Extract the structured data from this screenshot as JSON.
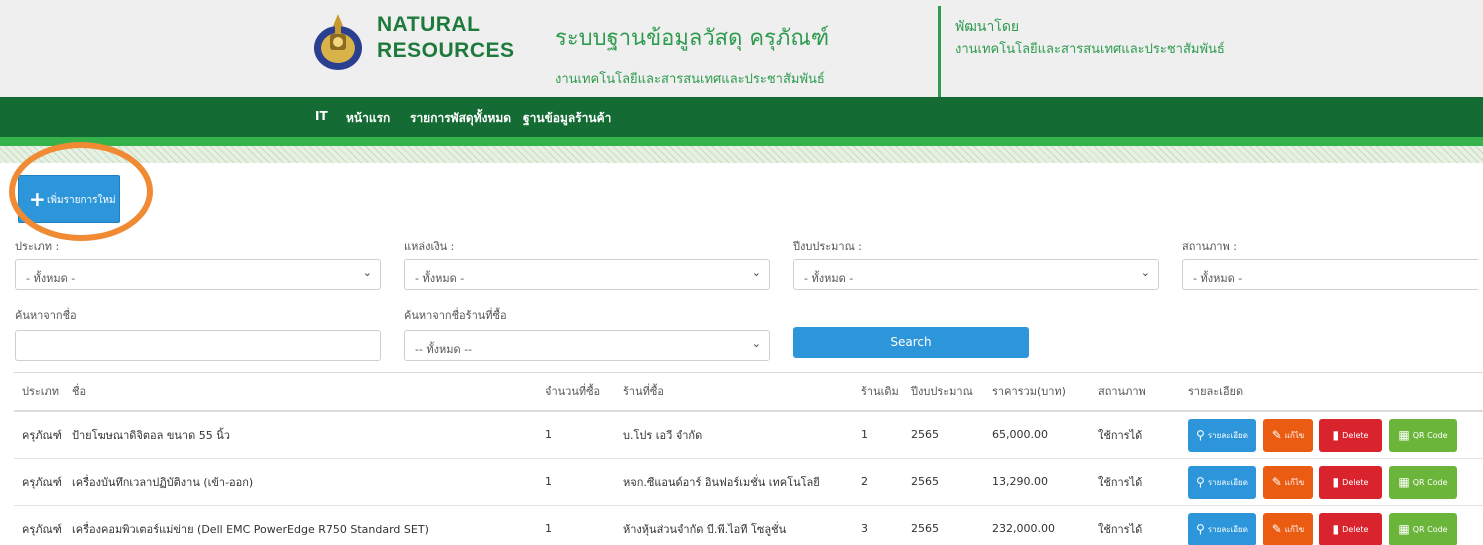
{
  "header": {
    "logo_line1": "NATURAL",
    "logo_line2": "RESOURCES",
    "site_title": "ระบบฐานข้อมูลวัสดุ ครุภัณฑ์",
    "site_subtitle": "งานเทคโนโลยีและสารสนเทศและประชาสัมพันธ์",
    "developed_by_label": "พัฒนาโดย",
    "developed_by_org": "งานเทคโนโลยีและสารสนเทศและประชาสัมพันธ์"
  },
  "nav": {
    "items": [
      "IT",
      "หน้าแรก",
      "รายการพัสดุทั้งหมด",
      "ฐานข้อมูลร้านค้า"
    ]
  },
  "add_button": {
    "label": "เพิ่มรายการใหม่"
  },
  "filters": {
    "type_label": "ประเภท :",
    "type_value": "- ทั้งหมด -",
    "funding_label": "แหล่งเงิน :",
    "funding_value": "- ทั้งหมด -",
    "fiscal_year_label": "ปีงบประมาณ :",
    "fiscal_year_value": "- ทั้งหมด -",
    "status_label": "สถานภาพ :",
    "status_value": "- ทั้งหมด -",
    "name_search_label": "ค้นหาจากชื่อ",
    "name_search_value": "",
    "shop_search_label": "ค้นหาจากชื่อร้านที่ซื้อ",
    "shop_search_value": "-- ทั้งหมด --",
    "search_button": "Search"
  },
  "table": {
    "headers": [
      "ประเภท",
      "ชื่อ",
      "จำนวนที่ซื้อ",
      "ร้านที่ซื้อ",
      "ร้านเดิม",
      "ปีงบประมาณ",
      "ราคารวม(บาท)",
      "สถานภาพ",
      "รายละเอียด"
    ],
    "rows": [
      [
        "ครุภัณฑ์",
        "ป้ายโฆษณาดิจิตอล ขนาด 55 นิ้ว",
        "1",
        "บ.โปร เอวี จำกัด",
        "1",
        "2565",
        "65,000.00",
        "ใช้การได้"
      ],
      [
        "ครุภัณฑ์",
        "เครื่องบันทึกเวลาปฏิบัติงาน (เข้า-ออก)",
        "1",
        "หจก.ซีแอนด์อาร์ อินฟอร์เมชั่น เทคโนโลยี",
        "2",
        "2565",
        "13,290.00",
        "ใช้การได้"
      ],
      [
        "ครุภัณฑ์",
        "เครื่องคอมพิวเตอร์แม่ข่าย (Dell EMC PowerEdge R750 Standard SET)",
        "1",
        "ห้างหุ้นส่วนจำกัด บี.พี.ไอที โซลูชั่น",
        "3",
        "2565",
        "232,000.00",
        "ใช้การได้"
      ]
    ],
    "action_labels": {
      "detail": "รายละเอียด",
      "edit": "แก้ไข",
      "delete": "Delete",
      "qr": "QR Code"
    }
  },
  "colors": {
    "nav_green": "#146b34",
    "accent_green": "#2f9b4f",
    "primary_blue": "#2d96db",
    "edit_orange": "#ea5c12",
    "delete_red": "#d9232d",
    "qr_green": "#6bb53b",
    "highlight_orange": "#f08a33"
  }
}
